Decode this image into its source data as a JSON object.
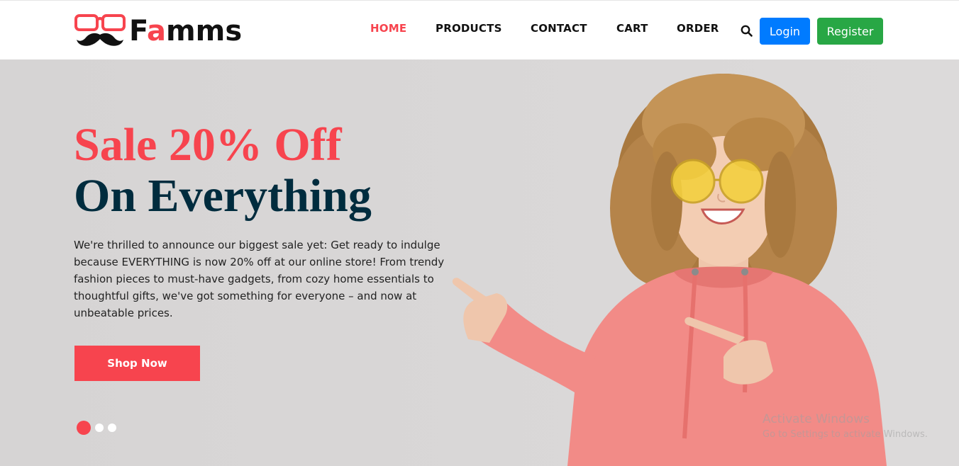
{
  "brand": {
    "name_prefix": "F",
    "name_accent": "a",
    "name_suffix": "mms",
    "accent_color": "#f7444e"
  },
  "nav": {
    "items": [
      {
        "label": "HOME",
        "active": true
      },
      {
        "label": "PRODUCTS",
        "active": false
      },
      {
        "label": "CONTACT",
        "active": false
      },
      {
        "label": "CART",
        "active": false
      },
      {
        "label": "ORDER",
        "active": false
      }
    ],
    "search_icon": "search-icon",
    "login_label": "Login",
    "register_label": "Register",
    "login_color": "#007bff",
    "register_color": "#28a745"
  },
  "hero": {
    "title_line1": "Sale 20% Off",
    "title_line2": "On Everything",
    "title_line1_color": "#f7444e",
    "title_line2_color": "#002c3e",
    "description": "We're thrilled to announce our biggest sale yet: Get ready to indulge because EVERYTHING is now 20% off at our online store! From trendy fashion pieces to must-have gadgets, from cozy home essentials to thoughtful gifts, we've got something for everyone – and now at unbeatable prices.",
    "cta_label": "Shop Now",
    "slides_total": 3,
    "active_slide": 1
  },
  "watermark": {
    "line1": "Activate Windows",
    "line2": "Go to Settings to activate Windows."
  }
}
